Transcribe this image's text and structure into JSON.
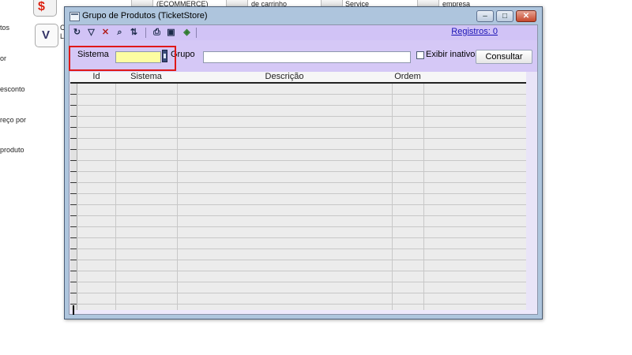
{
  "background_app": {
    "top_items": [
      "(ECOMMERCE)",
      "de carrinho",
      "Service",
      "empresa"
    ],
    "left_items": [
      "tos",
      "or",
      "esconto",
      "reço por",
      "produto"
    ],
    "side_text_1": "C",
    "side_text_2": "L"
  },
  "window": {
    "title": "Grupo de Produtos (TicketStore)",
    "records_label": "Registros: 0"
  },
  "filters": {
    "sistema_label": "Sistema",
    "sistema_value": "",
    "grupo_label": "Grupo",
    "grupo_value": "",
    "exibir_inativos_label": "Exibir inativos",
    "exibir_inativos_checked": false,
    "consultar_label": "Consultar"
  },
  "grid": {
    "columns": [
      "Id",
      "Sistema",
      "Descrição",
      "Ordem"
    ],
    "rows": []
  },
  "toolbar": {
    "icons": [
      "refresh-icon",
      "filter-icon",
      "clear-filter-icon",
      "search-icon",
      "sort-icon",
      "print-icon",
      "save-icon",
      "export-icon"
    ]
  },
  "colors": {
    "client_background": "#ede8fb",
    "toolbar": "#d1c3f6",
    "highlight": "#e01919",
    "sistema_input": "#fdfda2",
    "link": "#1a12b5"
  }
}
